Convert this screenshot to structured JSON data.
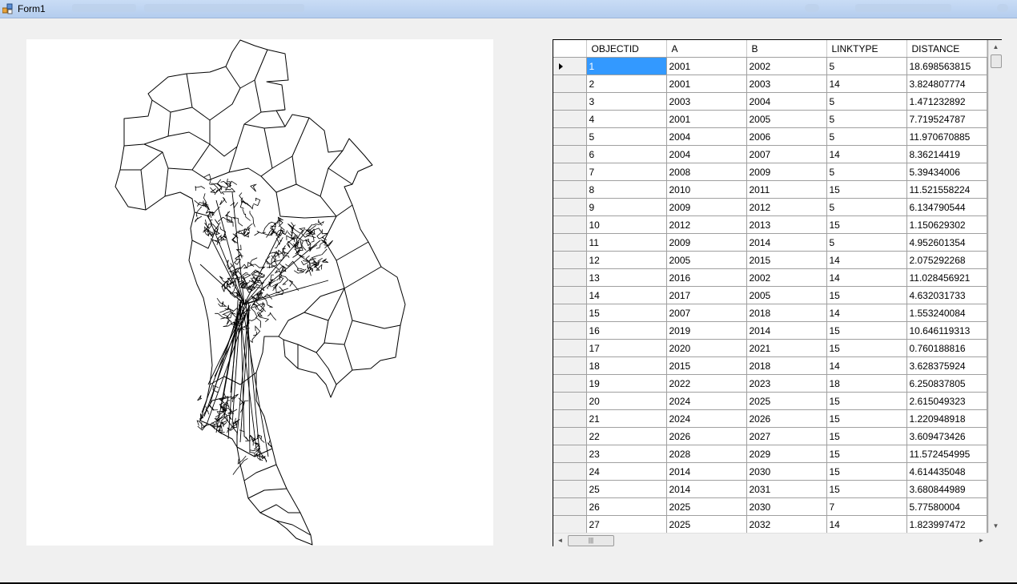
{
  "window": {
    "title": "Form1"
  },
  "grid": {
    "columns": [
      "OBJECTID",
      "A",
      "B",
      "LINKTYPE",
      "DISTANCE"
    ],
    "rows": [
      [
        "1",
        "2001",
        "2002",
        "5",
        "18.698563815"
      ],
      [
        "2",
        "2001",
        "2003",
        "14",
        "3.824807774"
      ],
      [
        "3",
        "2003",
        "2004",
        "5",
        "1.471232892"
      ],
      [
        "4",
        "2001",
        "2005",
        "5",
        "7.719524787"
      ],
      [
        "5",
        "2004",
        "2006",
        "5",
        "11.970670885"
      ],
      [
        "6",
        "2004",
        "2007",
        "14",
        "8.36214419"
      ],
      [
        "7",
        "2008",
        "2009",
        "5",
        "5.39434006"
      ],
      [
        "8",
        "2010",
        "2011",
        "15",
        "11.521558224"
      ],
      [
        "9",
        "2009",
        "2012",
        "5",
        "6.134790544"
      ],
      [
        "10",
        "2012",
        "2013",
        "15",
        "1.150629302"
      ],
      [
        "11",
        "2009",
        "2014",
        "5",
        "4.952601354"
      ],
      [
        "12",
        "2005",
        "2015",
        "14",
        "2.075292268"
      ],
      [
        "13",
        "2016",
        "2002",
        "14",
        "11.028456921"
      ],
      [
        "14",
        "2017",
        "2005",
        "15",
        "4.632031733"
      ],
      [
        "15",
        "2007",
        "2018",
        "14",
        "1.553240084"
      ],
      [
        "16",
        "2019",
        "2014",
        "15",
        "10.646119313"
      ],
      [
        "17",
        "2020",
        "2021",
        "15",
        "0.760188816"
      ],
      [
        "18",
        "2015",
        "2018",
        "14",
        "3.628375924"
      ],
      [
        "19",
        "2022",
        "2023",
        "18",
        "6.250837805"
      ],
      [
        "20",
        "2024",
        "2025",
        "15",
        "2.615049323"
      ],
      [
        "21",
        "2024",
        "2026",
        "15",
        "1.220948918"
      ],
      [
        "22",
        "2026",
        "2027",
        "15",
        "3.609473426"
      ],
      [
        "23",
        "2028",
        "2029",
        "15",
        "11.572454995"
      ],
      [
        "24",
        "2014",
        "2030",
        "15",
        "4.614435048"
      ],
      [
        "25",
        "2014",
        "2031",
        "15",
        "3.680844989"
      ],
      [
        "26",
        "2025",
        "2030",
        "7",
        "5.77580004"
      ],
      [
        "27",
        "2025",
        "2032",
        "14",
        "1.823997472"
      ]
    ],
    "selected_row": 0
  },
  "icons": {
    "app": "app-icon",
    "current_row": "current-row-arrow-icon",
    "scroll_up": "scroll-up-icon",
    "scroll_down": "scroll-down-icon",
    "scroll_left": "scroll-left-icon",
    "scroll_right": "scroll-right-icon"
  }
}
